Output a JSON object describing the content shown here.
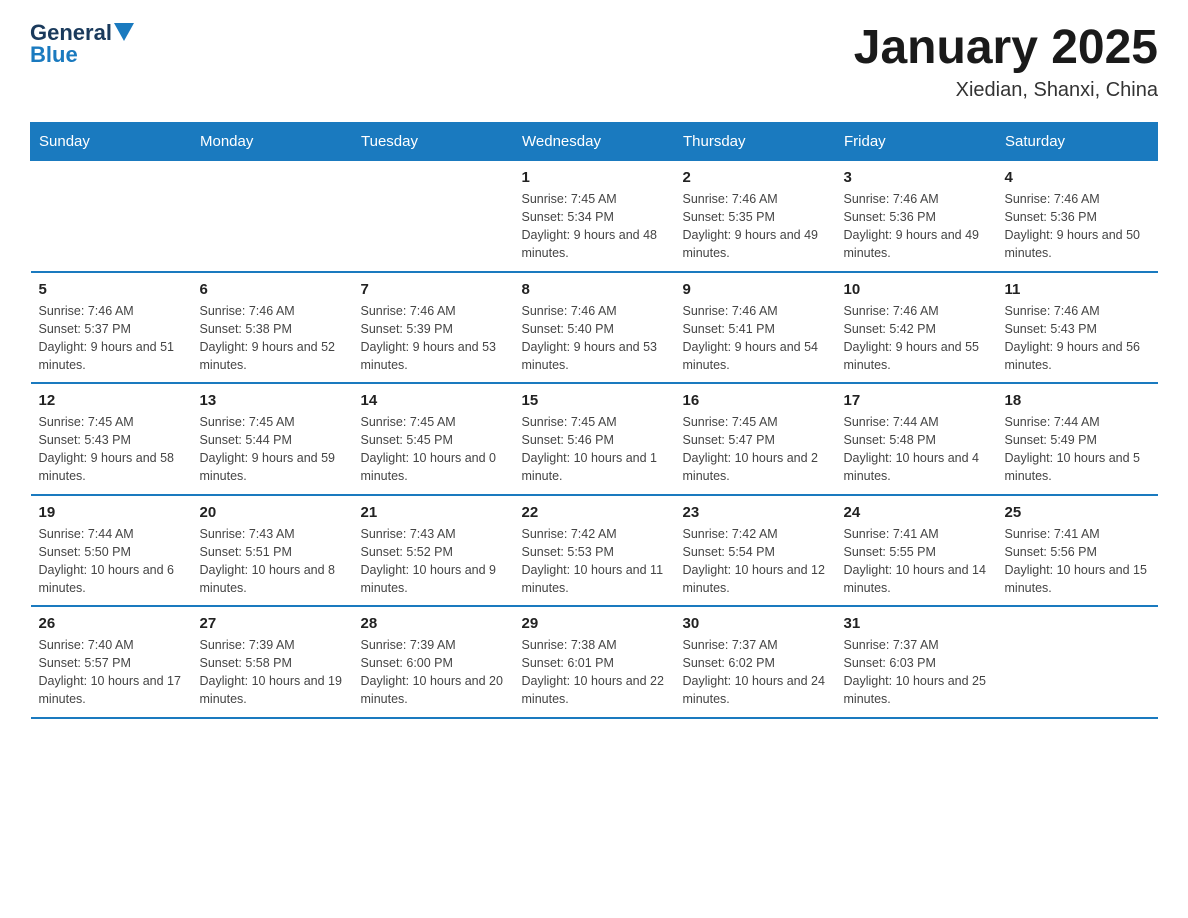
{
  "logo": {
    "general": "General",
    "blue": "Blue"
  },
  "title": "January 2025",
  "subtitle": "Xiedian, Shanxi, China",
  "headers": [
    "Sunday",
    "Monday",
    "Tuesday",
    "Wednesday",
    "Thursday",
    "Friday",
    "Saturday"
  ],
  "weeks": [
    [
      {
        "day": "",
        "info": ""
      },
      {
        "day": "",
        "info": ""
      },
      {
        "day": "",
        "info": ""
      },
      {
        "day": "1",
        "info": "Sunrise: 7:45 AM\nSunset: 5:34 PM\nDaylight: 9 hours and 48 minutes."
      },
      {
        "day": "2",
        "info": "Sunrise: 7:46 AM\nSunset: 5:35 PM\nDaylight: 9 hours and 49 minutes."
      },
      {
        "day": "3",
        "info": "Sunrise: 7:46 AM\nSunset: 5:36 PM\nDaylight: 9 hours and 49 minutes."
      },
      {
        "day": "4",
        "info": "Sunrise: 7:46 AM\nSunset: 5:36 PM\nDaylight: 9 hours and 50 minutes."
      }
    ],
    [
      {
        "day": "5",
        "info": "Sunrise: 7:46 AM\nSunset: 5:37 PM\nDaylight: 9 hours and 51 minutes."
      },
      {
        "day": "6",
        "info": "Sunrise: 7:46 AM\nSunset: 5:38 PM\nDaylight: 9 hours and 52 minutes."
      },
      {
        "day": "7",
        "info": "Sunrise: 7:46 AM\nSunset: 5:39 PM\nDaylight: 9 hours and 53 minutes."
      },
      {
        "day": "8",
        "info": "Sunrise: 7:46 AM\nSunset: 5:40 PM\nDaylight: 9 hours and 53 minutes."
      },
      {
        "day": "9",
        "info": "Sunrise: 7:46 AM\nSunset: 5:41 PM\nDaylight: 9 hours and 54 minutes."
      },
      {
        "day": "10",
        "info": "Sunrise: 7:46 AM\nSunset: 5:42 PM\nDaylight: 9 hours and 55 minutes."
      },
      {
        "day": "11",
        "info": "Sunrise: 7:46 AM\nSunset: 5:43 PM\nDaylight: 9 hours and 56 minutes."
      }
    ],
    [
      {
        "day": "12",
        "info": "Sunrise: 7:45 AM\nSunset: 5:43 PM\nDaylight: 9 hours and 58 minutes."
      },
      {
        "day": "13",
        "info": "Sunrise: 7:45 AM\nSunset: 5:44 PM\nDaylight: 9 hours and 59 minutes."
      },
      {
        "day": "14",
        "info": "Sunrise: 7:45 AM\nSunset: 5:45 PM\nDaylight: 10 hours and 0 minutes."
      },
      {
        "day": "15",
        "info": "Sunrise: 7:45 AM\nSunset: 5:46 PM\nDaylight: 10 hours and 1 minute."
      },
      {
        "day": "16",
        "info": "Sunrise: 7:45 AM\nSunset: 5:47 PM\nDaylight: 10 hours and 2 minutes."
      },
      {
        "day": "17",
        "info": "Sunrise: 7:44 AM\nSunset: 5:48 PM\nDaylight: 10 hours and 4 minutes."
      },
      {
        "day": "18",
        "info": "Sunrise: 7:44 AM\nSunset: 5:49 PM\nDaylight: 10 hours and 5 minutes."
      }
    ],
    [
      {
        "day": "19",
        "info": "Sunrise: 7:44 AM\nSunset: 5:50 PM\nDaylight: 10 hours and 6 minutes."
      },
      {
        "day": "20",
        "info": "Sunrise: 7:43 AM\nSunset: 5:51 PM\nDaylight: 10 hours and 8 minutes."
      },
      {
        "day": "21",
        "info": "Sunrise: 7:43 AM\nSunset: 5:52 PM\nDaylight: 10 hours and 9 minutes."
      },
      {
        "day": "22",
        "info": "Sunrise: 7:42 AM\nSunset: 5:53 PM\nDaylight: 10 hours and 11 minutes."
      },
      {
        "day": "23",
        "info": "Sunrise: 7:42 AM\nSunset: 5:54 PM\nDaylight: 10 hours and 12 minutes."
      },
      {
        "day": "24",
        "info": "Sunrise: 7:41 AM\nSunset: 5:55 PM\nDaylight: 10 hours and 14 minutes."
      },
      {
        "day": "25",
        "info": "Sunrise: 7:41 AM\nSunset: 5:56 PM\nDaylight: 10 hours and 15 minutes."
      }
    ],
    [
      {
        "day": "26",
        "info": "Sunrise: 7:40 AM\nSunset: 5:57 PM\nDaylight: 10 hours and 17 minutes."
      },
      {
        "day": "27",
        "info": "Sunrise: 7:39 AM\nSunset: 5:58 PM\nDaylight: 10 hours and 19 minutes."
      },
      {
        "day": "28",
        "info": "Sunrise: 7:39 AM\nSunset: 6:00 PM\nDaylight: 10 hours and 20 minutes."
      },
      {
        "day": "29",
        "info": "Sunrise: 7:38 AM\nSunset: 6:01 PM\nDaylight: 10 hours and 22 minutes."
      },
      {
        "day": "30",
        "info": "Sunrise: 7:37 AM\nSunset: 6:02 PM\nDaylight: 10 hours and 24 minutes."
      },
      {
        "day": "31",
        "info": "Sunrise: 7:37 AM\nSunset: 6:03 PM\nDaylight: 10 hours and 25 minutes."
      },
      {
        "day": "",
        "info": ""
      }
    ]
  ]
}
